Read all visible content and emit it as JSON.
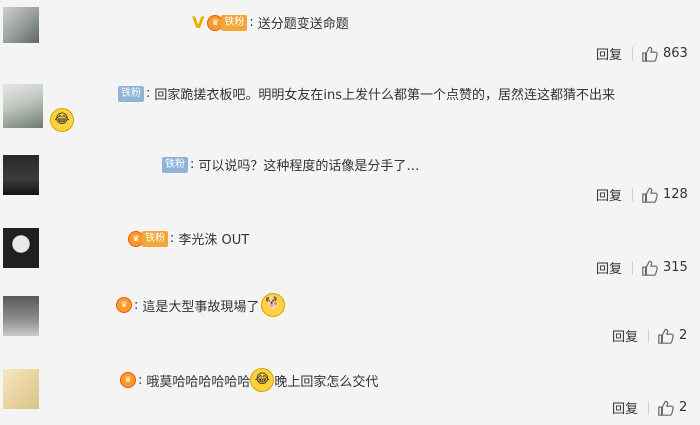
{
  "badges": {
    "tiefen": "铁粉"
  },
  "reply_label": "回复",
  "comments": [
    {
      "text": "送分题变送命题",
      "likes": "863"
    },
    {
      "text_line1": "回家跪搓衣板吧。明明女友在ins上发什么都第一个点赞的，居然连这都猜不出来"
    },
    {
      "text": "可以说吗？这种程度的话像是分手了…",
      "likes": "128"
    },
    {
      "text": "李光洙 OUT",
      "likes": "315"
    },
    {
      "text": "這是大型事故現場了",
      "likes": "2"
    },
    {
      "text": "哦莫哈哈哈哈哈哈",
      "text_after_emoji": "晚上回家怎么交代",
      "likes": "2"
    }
  ],
  "icons": [
    "thumb-up-icon",
    "laugh-emoji-icon",
    "shiba-emoji-icon",
    "crown-badge-icon"
  ],
  "colors": {
    "background": "#f4f4f4",
    "badge_blue": "#8fb3d8",
    "badge_gold": "#f3a536"
  }
}
